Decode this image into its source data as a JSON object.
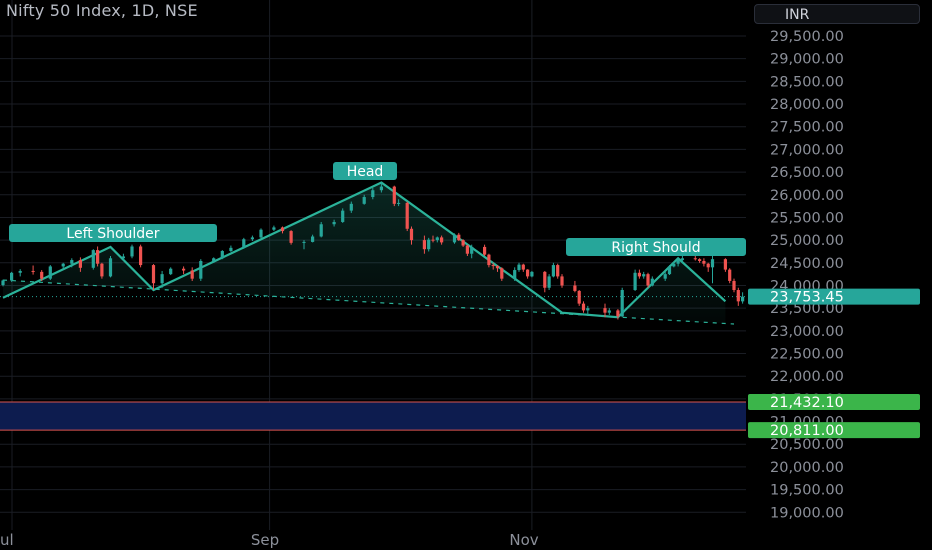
{
  "header": {
    "title": "Nifty 50 Index, 1D, NSE",
    "currency": "INR"
  },
  "colors": {
    "up": "#26a69a",
    "down": "#ef5350",
    "pattern": "#2bb39a",
    "label_bg": "#26a69a",
    "zone_fill": "#0d1c4f",
    "zone_edge": "#d9534f",
    "support_label": "#3bb54a",
    "grid": "#1a1d24",
    "axis_text": "#8c909a"
  },
  "chart_data": {
    "type": "candlestick",
    "title": "Nifty 50 Index, 1D, NSE",
    "ylim": [
      18750,
      29900
    ],
    "y_ticks": [
      "29,500.00",
      "29,000.00",
      "28,500.00",
      "28,000.00",
      "27,500.00",
      "27,000.00",
      "26,500.00",
      "26,000.00",
      "25,500.00",
      "25,000.00",
      "24,500.00",
      "24,000.00",
      "23,500.00",
      "23,000.00",
      "22,500.00",
      "22,000.00",
      "21,500.00",
      "21,000.00",
      "20,500.00",
      "20,000.00",
      "19,500.00",
      "19,000.00"
    ],
    "x_ticks": [
      "Jul",
      "Sep",
      "Nov"
    ],
    "last_price": "23,753.45",
    "zone": {
      "upper": 21432.1,
      "lower": 20811.0,
      "upper_label": "21,432.10",
      "lower_label": "20,811.00"
    },
    "pattern": {
      "name": "Head and Shoulders",
      "labels": [
        "Left Shoulder",
        "Head",
        "Right Should"
      ],
      "points": [
        [
          "Jul 1",
          23730
        ],
        [
          "Jul 26",
          24850
        ],
        [
          "Aug 5",
          23900
        ],
        [
          "Sep 27",
          26270
        ],
        [
          "Nov 8",
          23400
        ],
        [
          "Nov 21",
          23300
        ],
        [
          "Dec 5",
          24600
        ],
        [
          "Dec 16",
          23650
        ]
      ]
    },
    "neckline": {
      "start": [
        "Jul 1",
        24120
      ],
      "end": [
        "Dec 18",
        23150
      ]
    },
    "last_price_line": 23753.45,
    "candles": [
      {
        "d": "Jul 1",
        "o": 24010,
        "h": 24130,
        "l": 23980,
        "c": 24110
      },
      {
        "d": "Jul 3",
        "o": 24110,
        "h": 24300,
        "l": 24080,
        "c": 24280
      },
      {
        "d": "Jul 5",
        "o": 24280,
        "h": 24360,
        "l": 24200,
        "c": 24320
      },
      {
        "d": "Jul 8",
        "o": 24320,
        "h": 24440,
        "l": 24240,
        "c": 24300
      },
      {
        "d": "Jul 10",
        "o": 24300,
        "h": 24340,
        "l": 24100,
        "c": 24150
      },
      {
        "d": "Jul 12",
        "o": 24150,
        "h": 24450,
        "l": 24120,
        "c": 24420
      },
      {
        "d": "Jul 15",
        "o": 24420,
        "h": 24500,
        "l": 24350,
        "c": 24480
      },
      {
        "d": "Jul 17",
        "o": 24480,
        "h": 24600,
        "l": 24400,
        "c": 24560
      },
      {
        "d": "Jul 19",
        "o": 24560,
        "h": 24620,
        "l": 24300,
        "c": 24390
      },
      {
        "d": "Jul 22",
        "o": 24390,
        "h": 24800,
        "l": 24350,
        "c": 24780
      },
      {
        "d": "Jul 23",
        "o": 24780,
        "h": 24860,
        "l": 24420,
        "c": 24480
      },
      {
        "d": "Jul 24",
        "o": 24480,
        "h": 24500,
        "l": 24150,
        "c": 24200
      },
      {
        "d": "Jul 26",
        "o": 24200,
        "h": 24650,
        "l": 24180,
        "c": 24600
      },
      {
        "d": "Jul 29",
        "o": 24600,
        "h": 24700,
        "l": 24550,
        "c": 24640
      },
      {
        "d": "Jul 31",
        "o": 24640,
        "h": 24900,
        "l": 24600,
        "c": 24860
      },
      {
        "d": "Aug 2",
        "o": 24860,
        "h": 24900,
        "l": 24400,
        "c": 24450
      },
      {
        "d": "Aug 5",
        "o": 24450,
        "h": 24470,
        "l": 23900,
        "c": 24050
      },
      {
        "d": "Aug 7",
        "o": 24050,
        "h": 24320,
        "l": 23950,
        "c": 24250
      },
      {
        "d": "Aug 9",
        "o": 24250,
        "h": 24400,
        "l": 24230,
        "c": 24370
      },
      {
        "d": "Aug 12",
        "o": 24370,
        "h": 24420,
        "l": 24250,
        "c": 24330
      },
      {
        "d": "Aug 14",
        "o": 24330,
        "h": 24400,
        "l": 24100,
        "c": 24150
      },
      {
        "d": "Aug 16",
        "o": 24150,
        "h": 24580,
        "l": 24100,
        "c": 24540
      },
      {
        "d": "Aug 19",
        "o": 24540,
        "h": 24620,
        "l": 24500,
        "c": 24600
      },
      {
        "d": "Aug 21",
        "o": 24600,
        "h": 24780,
        "l": 24580,
        "c": 24760
      },
      {
        "d": "Aug 23",
        "o": 24760,
        "h": 24880,
        "l": 24740,
        "c": 24830
      },
      {
        "d": "Aug 26",
        "o": 24830,
        "h": 25050,
        "l": 24810,
        "c": 25020
      },
      {
        "d": "Aug 28",
        "o": 25020,
        "h": 25100,
        "l": 24980,
        "c": 25060
      },
      {
        "d": "Aug 30",
        "o": 25060,
        "h": 25260,
        "l": 25040,
        "c": 25230
      },
      {
        "d": "Sep 2",
        "o": 25230,
        "h": 25320,
        "l": 25200,
        "c": 25280
      },
      {
        "d": "Sep 4",
        "o": 25280,
        "h": 25300,
        "l": 25150,
        "c": 25200
      },
      {
        "d": "Sep 6",
        "o": 25200,
        "h": 25220,
        "l": 24900,
        "c": 24940
      },
      {
        "d": "Sep 9",
        "o": 24940,
        "h": 25000,
        "l": 24800,
        "c": 24960
      },
      {
        "d": "Sep 11",
        "o": 24960,
        "h": 25120,
        "l": 24950,
        "c": 25080
      },
      {
        "d": "Sep 13",
        "o": 25080,
        "h": 25400,
        "l": 25060,
        "c": 25350
      },
      {
        "d": "Sep 16",
        "o": 25350,
        "h": 25450,
        "l": 25300,
        "c": 25400
      },
      {
        "d": "Sep 18",
        "o": 25400,
        "h": 25700,
        "l": 25380,
        "c": 25650
      },
      {
        "d": "Sep 20",
        "o": 25650,
        "h": 25850,
        "l": 25600,
        "c": 25800
      },
      {
        "d": "Sep 23",
        "o": 25800,
        "h": 26000,
        "l": 25780,
        "c": 25950
      },
      {
        "d": "Sep 25",
        "o": 25950,
        "h": 26150,
        "l": 25900,
        "c": 26100
      },
      {
        "d": "Sep 27",
        "o": 26100,
        "h": 26280,
        "l": 26050,
        "c": 26180
      },
      {
        "d": "Sep 30",
        "o": 26180,
        "h": 26200,
        "l": 25750,
        "c": 25800
      },
      {
        "d": "Oct 1",
        "o": 25800,
        "h": 25900,
        "l": 25750,
        "c": 25820
      },
      {
        "d": "Oct 3",
        "o": 25820,
        "h": 25850,
        "l": 25200,
        "c": 25250
      },
      {
        "d": "Oct 4",
        "o": 25250,
        "h": 25300,
        "l": 24900,
        "c": 25000
      },
      {
        "d": "Oct 7",
        "o": 25000,
        "h": 25100,
        "l": 24700,
        "c": 24800
      },
      {
        "d": "Oct 8",
        "o": 24800,
        "h": 25050,
        "l": 24750,
        "c": 25010
      },
      {
        "d": "Oct 9",
        "o": 25010,
        "h": 25100,
        "l": 24950,
        "c": 25000
      },
      {
        "d": "Oct 10",
        "o": 25000,
        "h": 25080,
        "l": 24950,
        "c": 25060
      },
      {
        "d": "Oct 11",
        "o": 25060,
        "h": 25100,
        "l": 24900,
        "c": 24950
      },
      {
        "d": "Oct 14",
        "o": 24950,
        "h": 25150,
        "l": 24920,
        "c": 25120
      },
      {
        "d": "Oct 15",
        "o": 25120,
        "h": 25160,
        "l": 24980,
        "c": 25000
      },
      {
        "d": "Oct 16",
        "o": 25000,
        "h": 25020,
        "l": 24850,
        "c": 24880
      },
      {
        "d": "Oct 17",
        "o": 24880,
        "h": 24900,
        "l": 24650,
        "c": 24700
      },
      {
        "d": "Oct 18",
        "o": 24700,
        "h": 24900,
        "l": 24600,
        "c": 24850
      },
      {
        "d": "Oct 21",
        "o": 24850,
        "h": 24900,
        "l": 24650,
        "c": 24680
      },
      {
        "d": "Oct 22",
        "o": 24680,
        "h": 24700,
        "l": 24400,
        "c": 24450
      },
      {
        "d": "Oct 23",
        "o": 24450,
        "h": 24500,
        "l": 24350,
        "c": 24430
      },
      {
        "d": "Oct 24",
        "o": 24430,
        "h": 24450,
        "l": 24300,
        "c": 24380
      },
      {
        "d": "Oct 25",
        "o": 24380,
        "h": 24400,
        "l": 24100,
        "c": 24150
      },
      {
        "d": "Oct 28",
        "o": 24150,
        "h": 24400,
        "l": 24100,
        "c": 24340
      },
      {
        "d": "Oct 29",
        "o": 24340,
        "h": 24500,
        "l": 24300,
        "c": 24460
      },
      {
        "d": "Oct 30",
        "o": 24460,
        "h": 24480,
        "l": 24300,
        "c": 24350
      },
      {
        "d": "Oct 31",
        "o": 24350,
        "h": 24360,
        "l": 24150,
        "c": 24200
      },
      {
        "d": "Nov 1",
        "o": 24200,
        "h": 24320,
        "l": 24180,
        "c": 24300
      },
      {
        "d": "Nov 4",
        "o": 24300,
        "h": 24320,
        "l": 23850,
        "c": 23950
      },
      {
        "d": "Nov 5",
        "o": 23950,
        "h": 24250,
        "l": 23900,
        "c": 24200
      },
      {
        "d": "Nov 6",
        "o": 24200,
        "h": 24500,
        "l": 24180,
        "c": 24450
      },
      {
        "d": "Nov 7",
        "o": 24450,
        "h": 24480,
        "l": 24150,
        "c": 24200
      },
      {
        "d": "Nov 8",
        "o": 24200,
        "h": 24250,
        "l": 23950,
        "c": 24000
      },
      {
        "d": "Nov 11",
        "o": 24000,
        "h": 24100,
        "l": 23850,
        "c": 23880
      },
      {
        "d": "Nov 12",
        "o": 23880,
        "h": 23900,
        "l": 23550,
        "c": 23600
      },
      {
        "d": "Nov 13",
        "o": 23600,
        "h": 23650,
        "l": 23400,
        "c": 23450
      },
      {
        "d": "Nov 14",
        "o": 23450,
        "h": 23550,
        "l": 23350,
        "c": 23500
      },
      {
        "d": "Nov 18",
        "o": 23500,
        "h": 23600,
        "l": 23300,
        "c": 23400
      },
      {
        "d": "Nov 19",
        "o": 23400,
        "h": 23500,
        "l": 23350,
        "c": 23450
      },
      {
        "d": "Nov 21",
        "o": 23450,
        "h": 23480,
        "l": 23250,
        "c": 23320
      },
      {
        "d": "Nov 22",
        "o": 23320,
        "h": 23950,
        "l": 23300,
        "c": 23900
      },
      {
        "d": "Nov 25",
        "o": 23900,
        "h": 24350,
        "l": 23880,
        "c": 24280
      },
      {
        "d": "Nov 26",
        "o": 24280,
        "h": 24350,
        "l": 24150,
        "c": 24200
      },
      {
        "d": "Nov 27",
        "o": 24200,
        "h": 24300,
        "l": 24150,
        "c": 24250
      },
      {
        "d": "Nov 28",
        "o": 24250,
        "h": 24280,
        "l": 23950,
        "c": 24000
      },
      {
        "d": "Nov 29",
        "o": 24000,
        "h": 24200,
        "l": 23980,
        "c": 24150
      },
      {
        "d": "Dec 2",
        "o": 24150,
        "h": 24300,
        "l": 24100,
        "c": 24250
      },
      {
        "d": "Dec 3",
        "o": 24250,
        "h": 24450,
        "l": 24230,
        "c": 24420
      },
      {
        "d": "Dec 4",
        "o": 24420,
        "h": 24520,
        "l": 24400,
        "c": 24480
      },
      {
        "d": "Dec 5",
        "o": 24480,
        "h": 24620,
        "l": 24420,
        "c": 24560
      },
      {
        "d": "Dec 6",
        "o": 24560,
        "h": 24650,
        "l": 24500,
        "c": 24600
      },
      {
        "d": "Dec 9",
        "o": 24600,
        "h": 24700,
        "l": 24550,
        "c": 24580
      },
      {
        "d": "Dec 10",
        "o": 24580,
        "h": 24600,
        "l": 24500,
        "c": 24540
      },
      {
        "d": "Dec 11",
        "o": 24540,
        "h": 24600,
        "l": 24420,
        "c": 24480
      },
      {
        "d": "Dec 12",
        "o": 24480,
        "h": 24500,
        "l": 24300,
        "c": 24400
      },
      {
        "d": "Dec 13",
        "o": 24400,
        "h": 24650,
        "l": 24050,
        "c": 24580
      },
      {
        "d": "Dec 16",
        "o": 24580,
        "h": 24600,
        "l": 24300,
        "c": 24350
      },
      {
        "d": "Dec 17",
        "o": 24350,
        "h": 24380,
        "l": 24050,
        "c": 24100
      },
      {
        "d": "Dec 18",
        "o": 24100,
        "h": 24150,
        "l": 23850,
        "c": 23900
      },
      {
        "d": "Dec 19",
        "o": 23900,
        "h": 23950,
        "l": 23550,
        "c": 23650
      },
      {
        "d": "Dec 20",
        "o": 23650,
        "h": 23850,
        "l": 23600,
        "c": 23753
      }
    ]
  }
}
